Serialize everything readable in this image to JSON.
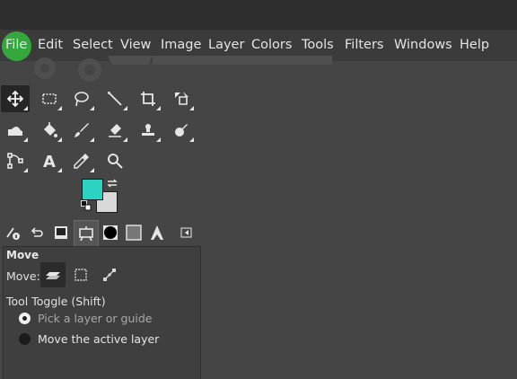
{
  "menubar": {
    "items": [
      "File",
      "Edit",
      "Select",
      "View",
      "Image",
      "Layer",
      "Colors",
      "Tools",
      "Filters",
      "Windows",
      "Help"
    ]
  },
  "toolbox": {
    "tools": [
      "move-tool",
      "rect-select-tool",
      "free-select-tool",
      "fuzzy-select-tool",
      "crop-tool",
      "unified-transform-tool",
      "warp-transform-tool",
      "bucket-fill-tool",
      "paintbrush-tool",
      "eraser-tool",
      "clone-tool",
      "smudge-tool",
      "paths-tool",
      "text-tool",
      "color-picker-tool",
      "zoom-tool"
    ],
    "active_tool": "move-tool",
    "fg_color": "#2ed2c2",
    "bg_color": "#d9d9d9"
  },
  "dock_tabs": [
    "device-status-icon",
    "undo-history-icon",
    "images-icon",
    "tool-options-icon",
    "brushes-icon",
    "patterns-icon",
    "gradients-icon"
  ],
  "tool_options": {
    "title": "Move",
    "move_label": "Move:",
    "move_modes": [
      "layer-mode-icon",
      "selection-mode-icon",
      "path-mode-icon"
    ],
    "active_mode": "layer-mode-icon",
    "toggle_label": "Tool Toggle  (Shift)",
    "options": [
      {
        "label": "Pick a layer or guide",
        "selected": true
      },
      {
        "label": "Move the active layer",
        "selected": false
      }
    ]
  }
}
